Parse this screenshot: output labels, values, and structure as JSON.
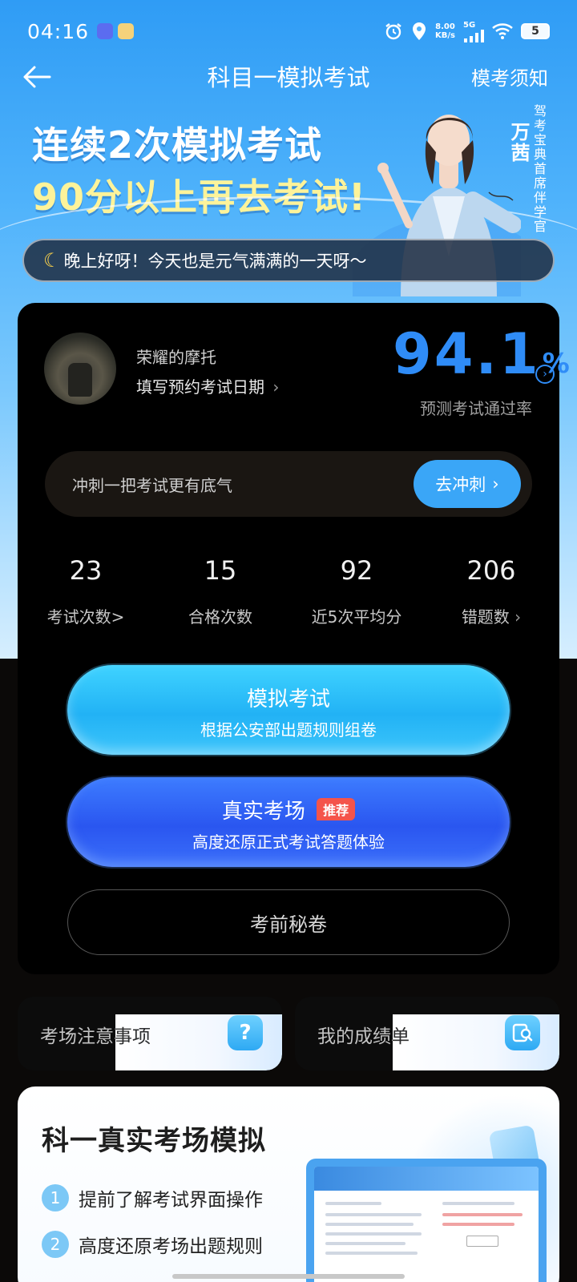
{
  "status_bar": {
    "time": "04:16",
    "net_speed_value": "8.00",
    "net_speed_unit": "KB/s",
    "net_type": "5G",
    "battery": "5"
  },
  "nav": {
    "title": "科目一模拟考试",
    "notice": "模考须知"
  },
  "banner": {
    "line1": "连续2次模拟考试",
    "line2": "90分以上再去考试!",
    "presenter_name": "万茜",
    "presenter_title": "驾考宝典首席伴学官"
  },
  "greeting": "晚上好呀！今天也是元气满满的一天呀～",
  "profile": {
    "user_name": "荣耀的摩托",
    "exam_date_link": "填写预约考试日期",
    "score": "94.1",
    "score_unit": "%",
    "score_label": "预测考试通过率"
  },
  "sprint": {
    "text": "冲刺一把考试更有底气",
    "button": "去冲刺"
  },
  "stats": [
    {
      "value": "23",
      "label": "考试次数>"
    },
    {
      "value": "15",
      "label": "合格次数"
    },
    {
      "value": "92",
      "label": "近5次平均分"
    },
    {
      "value": "206",
      "label": "错题数"
    }
  ],
  "buttons": {
    "mock_title": "模拟考试",
    "mock_subtitle": "根据公安部出题规则组卷",
    "real_title": "真实考场",
    "real_badge": "推荐",
    "real_subtitle": "高度还原正式考试答题体验",
    "secret": "考前秘卷"
  },
  "quick_cards": {
    "notes": "考场注意事项",
    "scores": "我的成绩单"
  },
  "simulation": {
    "title": "科一真实考场模拟",
    "items": [
      {
        "num": "1",
        "text": "提前了解考试界面操作"
      },
      {
        "num": "2",
        "text": "高度还原考场出题规则"
      }
    ]
  },
  "colors": {
    "accent_blue": "#2f8cf7",
    "button_cyan": "#22b2f5",
    "button_blue": "#2a56f0",
    "badge_red": "#f4544b",
    "banner_yellow": "#fdf39a"
  }
}
